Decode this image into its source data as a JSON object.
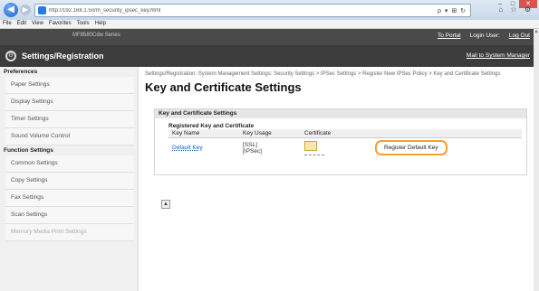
{
  "browser": {
    "url": "http://192.168.1.50/m_security_ipsec_key.html",
    "addr_icons": "ρ ▾ ⊞ ↻",
    "tab_icons": "⌂ ☆ ⚙",
    "back_icon": "◀",
    "forward_icon": "▶"
  },
  "menu": [
    "File",
    "Edit",
    "View",
    "Favorites",
    "Tools",
    "Help"
  ],
  "header": {
    "device": "MF8580Cdw Series",
    "to_portal": "To Portal",
    "login_user": "Login User:",
    "log_out": "Log Out",
    "title": "Settings/Registration",
    "mail": "Mail to System Manager"
  },
  "sidebar": {
    "preferences_heading": "Preferences",
    "preferences": [
      "Paper Settings",
      "Display Settings",
      "Timer Settings",
      "Sound Volume Control"
    ],
    "function_heading": "Function Settings",
    "functions": [
      "Common Settings",
      "Copy Settings",
      "Fax Settings",
      "Scan Settings",
      "Memory Media Print Settings"
    ]
  },
  "main": {
    "breadcrumb": "Settings/Registration: System Management Settings: Security Settings > IPSec Settings > Register New IPSec Policy > Key and Certificate Settings",
    "title": "Key and Certificate Settings",
    "panel_heading": "Key and Certificate Settings",
    "subheading": "Registered Key and Certificate",
    "columns": [
      "Key Name",
      "Key Usage",
      "Certificate"
    ],
    "row": {
      "key_name": "Default Key",
      "usage_1": "[SSL]",
      "usage_2": "[IPSec]"
    },
    "register_button": "Register Default Key"
  },
  "colors": {
    "accent": "#f0a030",
    "header_bg": "#3c3c3c",
    "link": "#1a5fb4"
  }
}
